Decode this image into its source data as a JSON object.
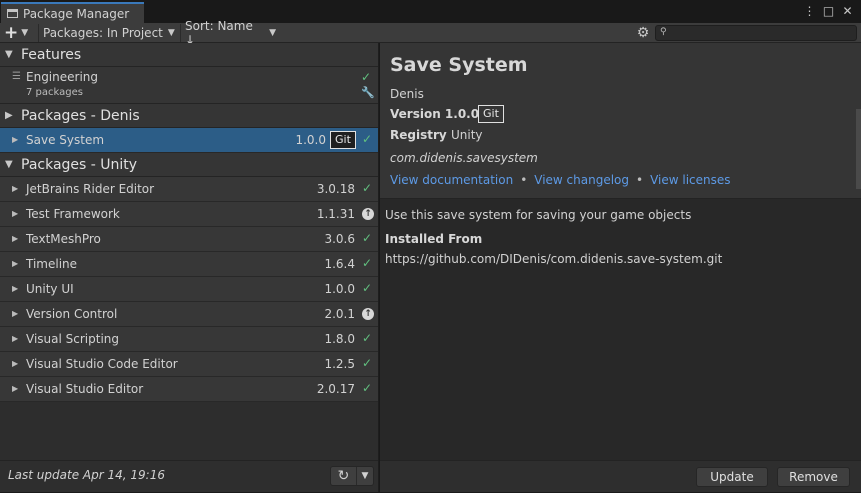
{
  "window": {
    "title": "Package Manager",
    "menu_icon": "kebab-menu-icon",
    "maximize_icon": "maximize-icon",
    "close_icon": "close-icon"
  },
  "toolbar": {
    "add_label": "+",
    "packages_dropdown": "Packages: In Project",
    "sort_dropdown": "Sort: Name ↓",
    "search_placeholder": ""
  },
  "sections": {
    "features": "Features",
    "denis": "Packages - Denis",
    "unity": "Packages - Unity"
  },
  "features": [
    {
      "name": "Engineering",
      "count": "7 packages",
      "status": "installed"
    }
  ],
  "denis_packages": [
    {
      "name": "Save System",
      "version": "1.0.0",
      "badge": "Git",
      "status": "installed"
    }
  ],
  "unity_packages": [
    {
      "name": "JetBrains Rider Editor",
      "version": "3.0.18",
      "status": "installed"
    },
    {
      "name": "Test Framework",
      "version": "1.1.31",
      "status": "update"
    },
    {
      "name": "TextMeshPro",
      "version": "3.0.6",
      "status": "installed"
    },
    {
      "name": "Timeline",
      "version": "1.6.4",
      "status": "installed"
    },
    {
      "name": "Unity UI",
      "version": "1.0.0",
      "status": "installed"
    },
    {
      "name": "Version Control",
      "version": "2.0.1",
      "status": "update"
    },
    {
      "name": "Visual Scripting",
      "version": "1.8.0",
      "status": "installed"
    },
    {
      "name": "Visual Studio Code Editor",
      "version": "1.2.5",
      "status": "installed"
    },
    {
      "name": "Visual Studio Editor",
      "version": "2.0.17",
      "status": "installed"
    }
  ],
  "footer": {
    "last_update": "Last update Apr 14, 19:16"
  },
  "detail": {
    "title": "Save System",
    "author": "Denis",
    "version_label": "Version 1.0.0",
    "version_badge": "Git",
    "registry_label": "Registry",
    "registry_value": "Unity",
    "package_id": "com.didenis.savesystem",
    "links": [
      "View documentation",
      "View changelog",
      "View licenses"
    ],
    "description": "Use this save system for saving your game objects",
    "installed_from_label": "Installed From",
    "installed_from_url": "https://github.com/DIDenis/com.didenis.save-system.git",
    "update_button": "Update",
    "remove_button": "Remove"
  },
  "colors": {
    "selected_row": "#2c5d87",
    "accent_tab": "#3a79bb",
    "link": "#5d9ae6",
    "check": "#61c07f"
  }
}
